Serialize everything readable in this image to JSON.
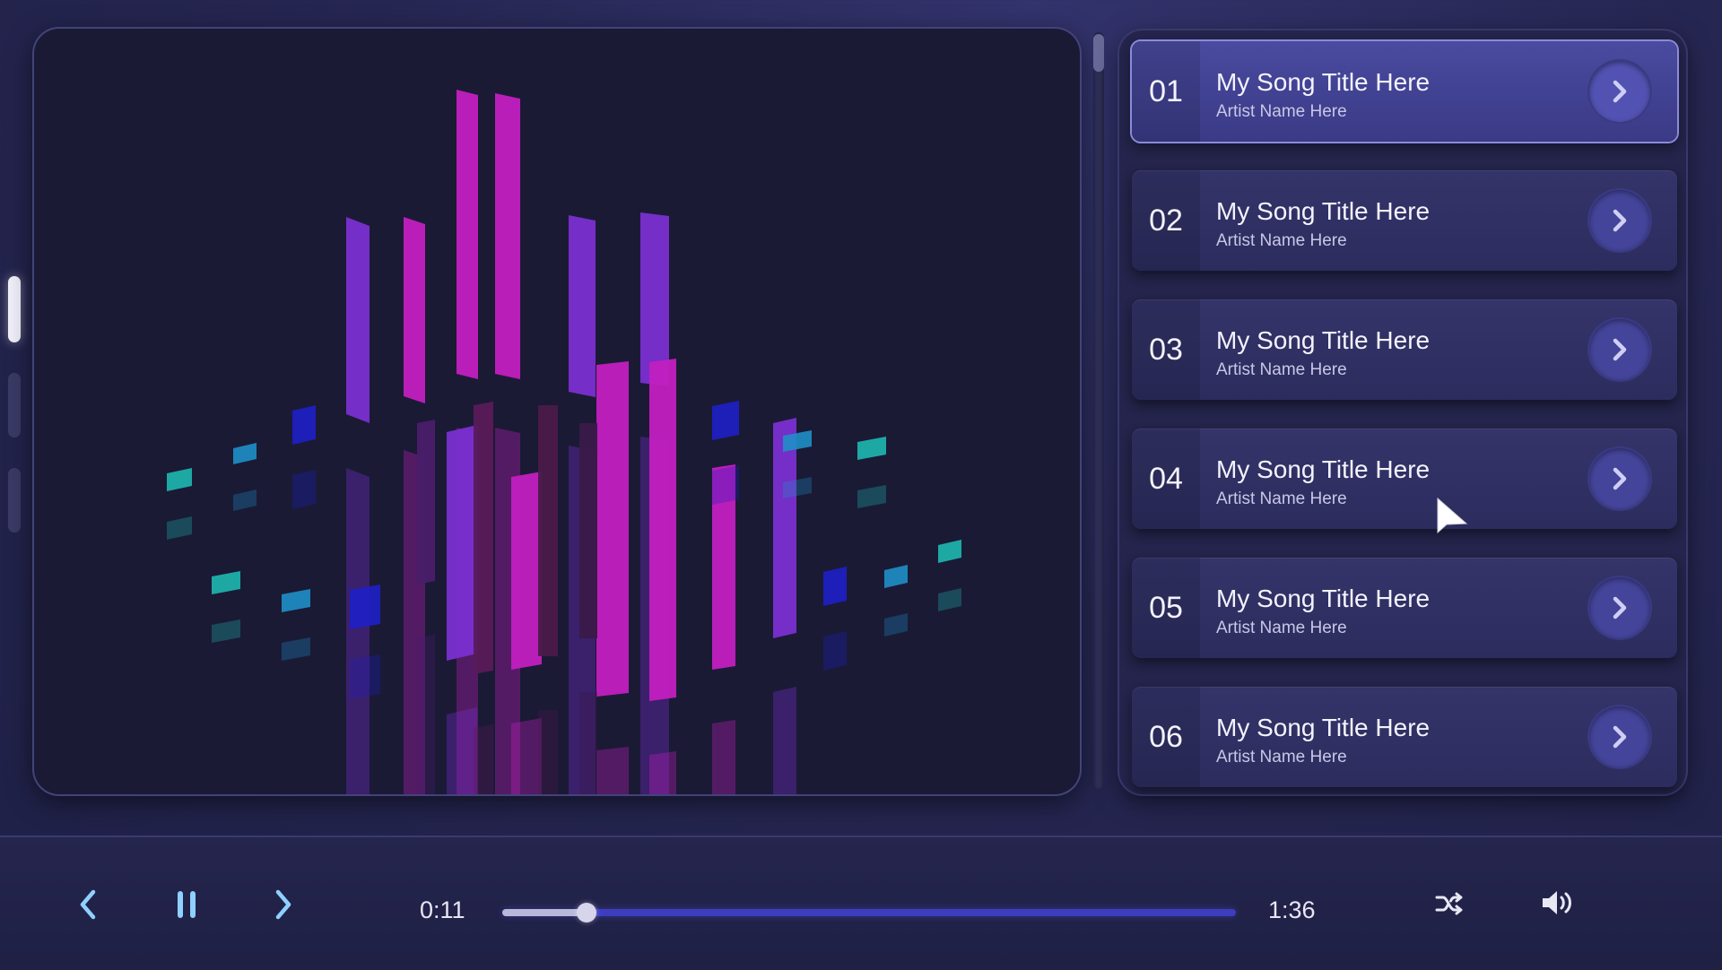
{
  "pager": {
    "count": 3,
    "active_index": 0
  },
  "playlist": {
    "tracks": [
      {
        "number": "01",
        "title": "My Song Title Here",
        "artist": "Artist Name Here",
        "active": true
      },
      {
        "number": "02",
        "title": "My Song Title Here",
        "artist": "Artist Name Here",
        "active": false
      },
      {
        "number": "03",
        "title": "My Song Title Here",
        "artist": "Artist Name Here",
        "active": false
      },
      {
        "number": "04",
        "title": "My Song Title Here",
        "artist": "Artist Name Here",
        "active": false
      },
      {
        "number": "05",
        "title": "My Song Title Here",
        "artist": "Artist Name Here",
        "active": false
      },
      {
        "number": "06",
        "title": "My Song Title Here",
        "artist": "Artist Name Here",
        "active": false
      }
    ],
    "play_icon": "chevron-right-icon"
  },
  "player": {
    "current_time": "0:11",
    "total_time": "1:36",
    "progress_fraction": 0.115,
    "icons": {
      "previous": "chevron-left-icon",
      "pause": "pause-icon",
      "next": "chevron-right-icon",
      "shuffle": "shuffle-icon",
      "volume": "volume-icon"
    }
  },
  "colors": {
    "accent_magenta": "#c21fc0",
    "accent_purple": "#7a2fd0",
    "accent_blue": "#1f1fc8",
    "accent_teal": "#1fb8b0",
    "progress_track": "#3d3dc0"
  }
}
